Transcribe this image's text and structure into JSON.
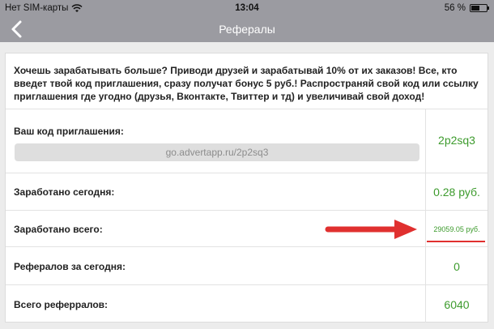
{
  "status_bar": {
    "carrier": "Нет SIM-карты",
    "time": "13:04",
    "battery": "56 %",
    "battery_level": 0.56
  },
  "nav": {
    "title": "Рефералы"
  },
  "intro_text": "Хочешь зарабатывать больше? Приводи друзей и зарабатывай 10% от их заказов! Все, кто введет твой код приглашения, сразу получат бонус 5 руб.! Распространяй свой код или ссылку приглашения где угодно (друзья, Вконтакте, Твиттер и тд) и увеличивай свой доход!",
  "rows": [
    {
      "label": "Ваш код приглашения:",
      "value": "2p2sq3",
      "link": "go.advertapp.ru/2p2sq3"
    },
    {
      "label": "Заработано сегодня:",
      "value": "0.28 руб."
    },
    {
      "label": "Заработано всего:",
      "value": "29059.05 руб."
    },
    {
      "label": "Рефералов за сегодня:",
      "value": "0"
    },
    {
      "label": "Всего реферралов:",
      "value": "6040"
    }
  ],
  "colors": {
    "value_green": "#3d9b2d",
    "annotation_red": "#e0302f",
    "nav_gray": "#9b9ba1"
  }
}
